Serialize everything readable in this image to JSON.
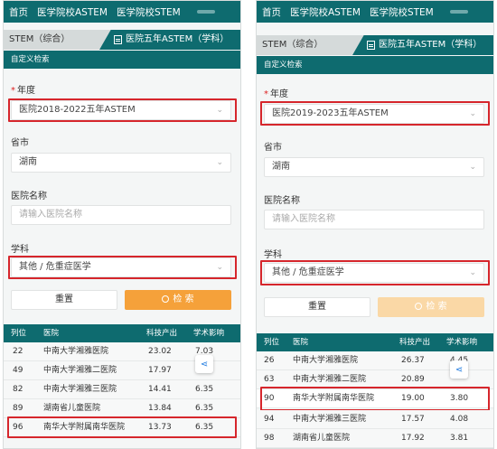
{
  "left": {
    "nav": [
      "首页",
      "医学院校ASTEM",
      "医学院校STEM"
    ],
    "tabs": {
      "inactive": "STEM（综合）",
      "active": "医院五年ASTEM（学科）"
    },
    "custom_search": "自定义检索",
    "year_label": "年度",
    "year_value": "医院2018-2022五年ASTEM",
    "province_label": "省市",
    "province_value": "湖南",
    "hospital_label": "医院名称",
    "hospital_placeholder": "请输入医院名称",
    "subject_label": "学科",
    "subject_value": "其他 / 危重症医学",
    "reset": "重置",
    "search": "检 索",
    "columns": [
      "列位",
      "医院",
      "科技产出",
      "学术影响"
    ],
    "rows": [
      [
        "22",
        "中南大学湘雅医院",
        "23.02",
        "7.03"
      ],
      [
        "49",
        "中南大学湘雅二医院",
        "17.97",
        ""
      ],
      [
        "82",
        "中南大学湘雅三医院",
        "14.41",
        "6.35"
      ],
      [
        "89",
        "湖南省儿童医院",
        "13.84",
        "6.35"
      ],
      [
        "96",
        "南华大学附属南华医院",
        "13.73",
        "6.35"
      ]
    ]
  },
  "right": {
    "nav": [
      "首页",
      "医学院校ASTEM",
      "医学院校STEM"
    ],
    "tabs": {
      "inactive": "STEM（综合）",
      "active": "医院五年ASTEM（学科）"
    },
    "custom_search": "自定义检索",
    "year_label": "年度",
    "year_value": "医院2019-2023五年ASTEM",
    "province_label": "省市",
    "province_value": "湖南",
    "hospital_label": "医院名称",
    "hospital_placeholder": "请输入医院名称",
    "subject_label": "学科",
    "subject_value": "其他 / 危重症医学",
    "reset": "重置",
    "search": "检 索",
    "columns": [
      "列位",
      "医院",
      "科技产出",
      "学术影响"
    ],
    "rows": [
      [
        "26",
        "中南大学湘雅医院",
        "26.37",
        "4.45"
      ],
      [
        "63",
        "中南大学湘雅二医院",
        "20.89",
        ""
      ],
      [
        "90",
        "南华大学附属南华医院",
        "19.00",
        "3.80"
      ],
      [
        "94",
        "中南大学湘雅三医院",
        "17.57",
        "4.08"
      ],
      [
        "98",
        "湖南省儿童医院",
        "17.92",
        "3.81"
      ]
    ]
  },
  "colors": {
    "primary": "#0e6b6f",
    "accent": "#f5a13a",
    "highlight": "#d6262c"
  },
  "icons": {
    "share": "share-icon",
    "doc": "doc-icon",
    "search": "search-icon"
  }
}
